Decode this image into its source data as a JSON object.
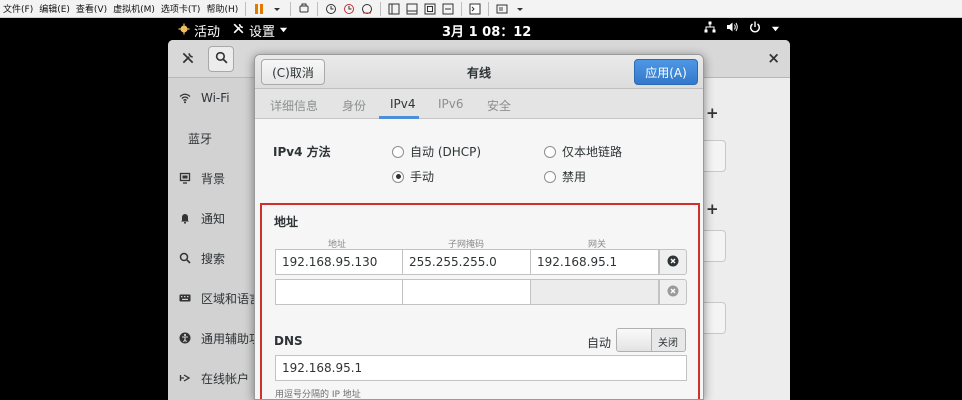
{
  "vmware": {
    "menu": [
      "文件(F)",
      "编辑(E)",
      "查看(V)",
      "虚拟机(M)",
      "选项卡(T)",
      "帮助(H)"
    ]
  },
  "topbar": {
    "activities": "活动",
    "app_menu": "设置",
    "clock": "3月 1 08：12"
  },
  "settings": {
    "sidebar": [
      {
        "label": "Wi-Fi",
        "icon": "wifi-icon"
      },
      {
        "label": "蓝牙",
        "icon": ""
      },
      {
        "label": "背景",
        "icon": "background-icon"
      },
      {
        "label": "通知",
        "icon": "bell-icon"
      },
      {
        "label": "搜索",
        "icon": "search-icon"
      },
      {
        "label": "区域和语言",
        "icon": "keyboard-icon"
      },
      {
        "label": "通用辅助功能",
        "icon": "accessibility-icon"
      },
      {
        "label": "在线帐户",
        "icon": "online-accounts-icon"
      }
    ],
    "plus_symbol": "+",
    "close_symbol": "×"
  },
  "dialog": {
    "cancel_label": "(C)取消",
    "title": "有线",
    "apply_label": "应用(A)",
    "tabs": [
      "详细信息",
      "身份",
      "IPv4",
      "IPv6",
      "安全"
    ],
    "active_tab": "IPv4",
    "method_label": "IPv4 方法",
    "methods": [
      {
        "label": "自动 (DHCP)",
        "selected": false
      },
      {
        "label": "仅本地链路",
        "selected": false
      },
      {
        "label": "手动",
        "selected": true
      },
      {
        "label": "禁用",
        "selected": false
      }
    ],
    "address": {
      "title": "地址",
      "headers": [
        "地址",
        "子网掩码",
        "网关"
      ],
      "rows": [
        [
          "192.168.95.130",
          "255.255.255.0",
          "192.168.95.1"
        ],
        [
          "",
          "",
          ""
        ]
      ]
    },
    "dns": {
      "label": "DNS",
      "auto_label": "自动",
      "switch_label": "关闭",
      "value": "192.168.95.1",
      "help": "用逗号分隔的 IP 地址"
    },
    "highlight_color": "#d0302a",
    "accent_color": "#3379cc"
  }
}
